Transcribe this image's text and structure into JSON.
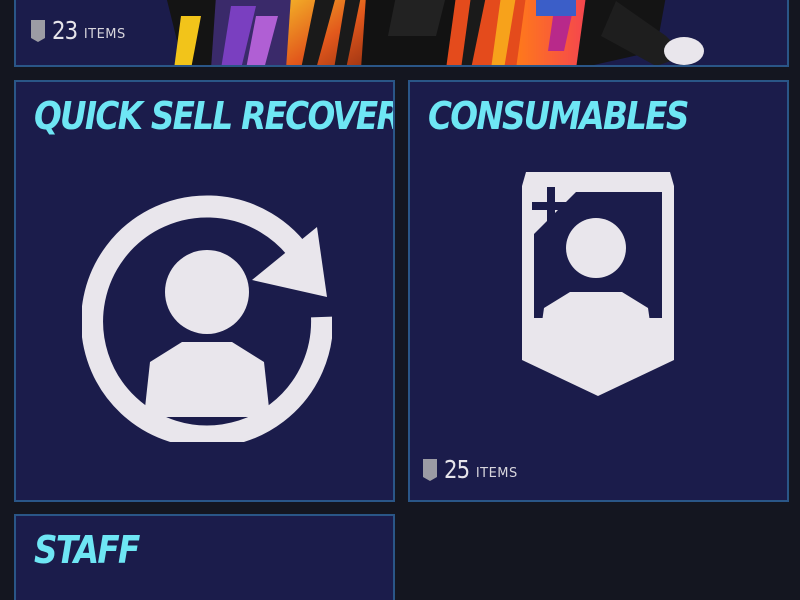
{
  "tiles": {
    "top": {
      "count": "23",
      "count_unit": "ITEMS",
      "icons": {
        "card": "player-card-icon"
      }
    },
    "quick_sell_recovery": {
      "title": "QUICK SELL RECOVERY",
      "icon": "recycle-player-icon"
    },
    "consumables": {
      "title": "CONSUMABLES",
      "icon": "consumable-card-icon",
      "count": "25",
      "count_unit": "ITEMS",
      "card_icon": "player-card-icon"
    },
    "staff": {
      "title": "STAFF"
    }
  },
  "colors": {
    "background": "#141620",
    "tile": "#1b1c4b",
    "tile_border": "#2a5687",
    "title": "#6ee6f4",
    "icon": "#e9e6ec"
  }
}
